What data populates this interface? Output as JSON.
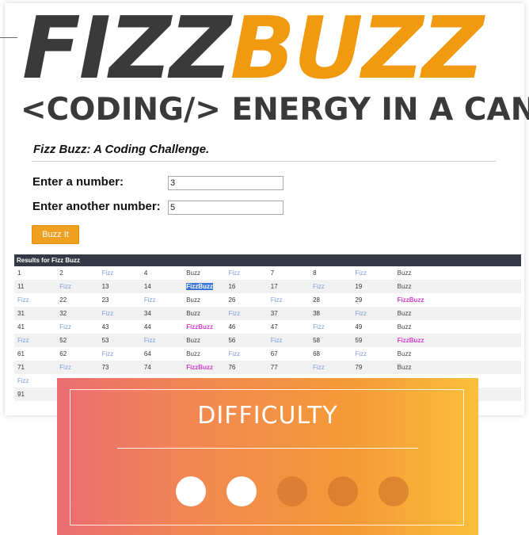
{
  "logo": {
    "fizz": "FIZZ",
    "buzz": "BUZZ"
  },
  "tagline": "<CODING/> ENERGY IN A CAN",
  "challenge": {
    "title": "Fizz Buzz: A Coding Challenge.",
    "label_first": "Enter a number:",
    "value_first": "3",
    "label_second": "Enter another number:",
    "value_second": "5",
    "button": "Buzz It"
  },
  "results": {
    "header": "Results for Fizz Buzz",
    "rows": [
      [
        "1",
        "2",
        "Fizz",
        "4",
        "Buzz",
        "Fizz",
        "7",
        "8",
        "Fizz",
        "Buzz"
      ],
      [
        "11",
        "Fizz",
        "13",
        "14",
        "FizzBuzz",
        "16",
        "17",
        "Fizz",
        "19",
        "Buzz"
      ],
      [
        "Fizz",
        "22",
        "23",
        "Fizz",
        "Buzz",
        "26",
        "Fizz",
        "28",
        "29",
        "FizzBuzz"
      ],
      [
        "31",
        "32",
        "Fizz",
        "34",
        "Buzz",
        "Fizz",
        "37",
        "38",
        "Fizz",
        "Buzz"
      ],
      [
        "41",
        "Fizz",
        "43",
        "44",
        "FizzBuzz",
        "46",
        "47",
        "Fizz",
        "49",
        "Buzz"
      ],
      [
        "Fizz",
        "52",
        "53",
        "Fizz",
        "Buzz",
        "56",
        "Fizz",
        "58",
        "59",
        "FizzBuzz"
      ],
      [
        "61",
        "62",
        "Fizz",
        "64",
        "Buzz",
        "Fizz",
        "67",
        "68",
        "Fizz",
        "Buzz"
      ],
      [
        "71",
        "Fizz",
        "73",
        "74",
        "FizzBuzz",
        "76",
        "77",
        "Fizz",
        "79",
        "Buzz"
      ],
      [
        "Fizz",
        "",
        "",
        "",
        "",
        "",
        "",
        "",
        "",
        ""
      ],
      [
        "91",
        "",
        "",
        "",
        "",
        "",
        "",
        "",
        "",
        ""
      ]
    ]
  },
  "difficulty": {
    "title": "DIFFICULTY",
    "level": 2,
    "max": 5
  },
  "colors": {
    "accent": "#f19a10",
    "fizz": "#7d9fd6",
    "fizzbuzz": "#d13fd1"
  }
}
